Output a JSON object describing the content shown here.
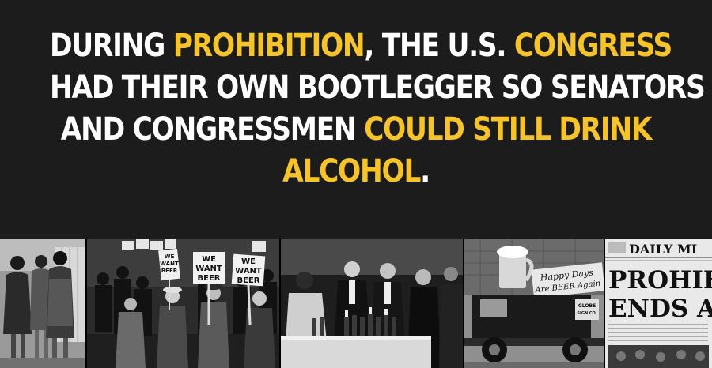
{
  "headline": {
    "lines": [
      [
        {
          "t": "DURING ",
          "hl": false
        },
        {
          "t": "PROHIBITION",
          "hl": true
        },
        {
          "t": ", THE U.S. ",
          "hl": false
        },
        {
          "t": "CONGRESS",
          "hl": true
        }
      ],
      [
        {
          "t": "HAD THEIR OWN BOOTLEGGER SO SENATORS",
          "hl": false
        }
      ],
      [
        {
          "t": "AND CONGRESSMEN ",
          "hl": false
        },
        {
          "t": "COULD STILL DRINK",
          "hl": true
        }
      ],
      [
        {
          "t": "ALCOHOL",
          "hl": true
        },
        {
          "t": ".",
          "hl": false
        }
      ]
    ]
  },
  "colors": {
    "background": "#1c1c1c",
    "text": "#ffffff",
    "highlight": "#f6c42a"
  },
  "photos": {
    "protest_sign_1": [
      "WE",
      "WANT",
      "BEER"
    ],
    "protest_sign_2": [
      "WE",
      "WANT",
      "BEER"
    ],
    "protest_sign_3": [
      "WE",
      "WANT",
      "BEER"
    ],
    "truck_banner": [
      "Happy Days",
      "Are BEER Again"
    ],
    "truck_sign": [
      "GLOBE",
      "SIGN CO."
    ],
    "newspaper_masthead": "DAILY MI",
    "newspaper_headline": [
      "PROHIB",
      "ENDS AT"
    ]
  }
}
